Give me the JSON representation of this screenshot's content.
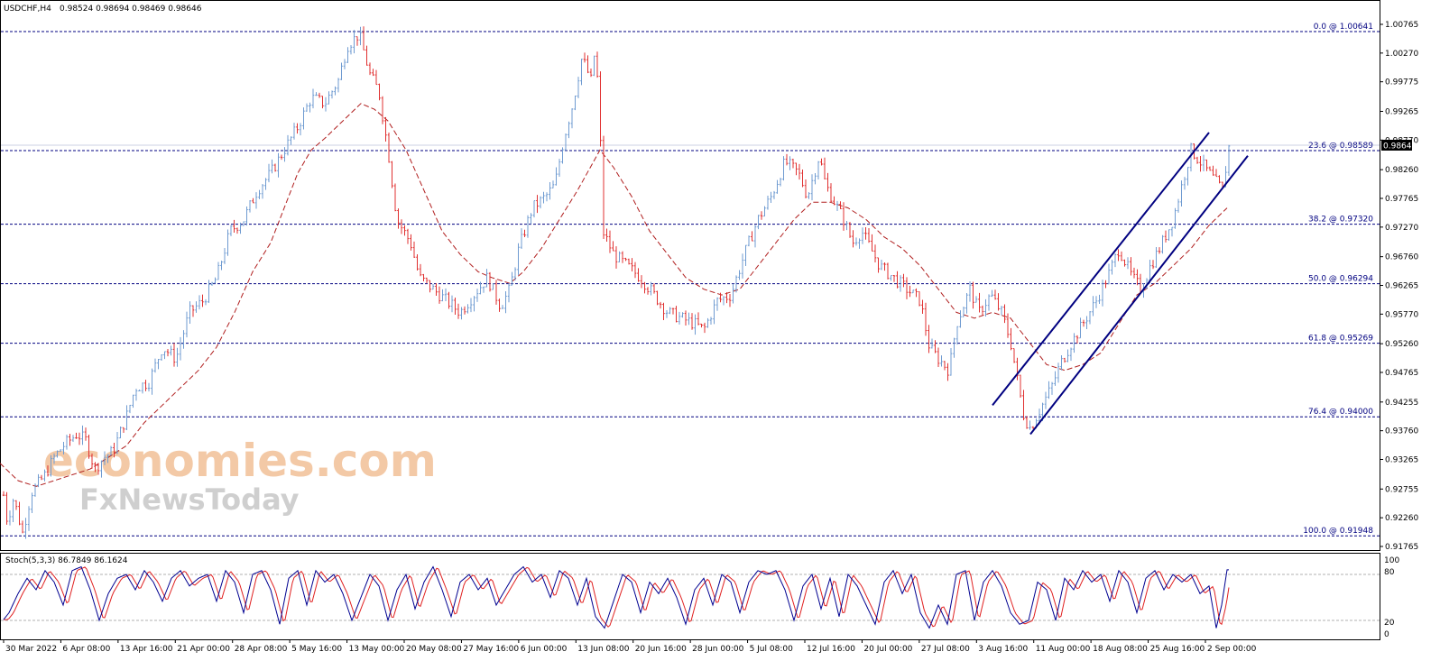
{
  "header": {
    "symbol": "USDCHF,H4",
    "ohlc": "0.98524 0.98694 0.98469 0.98646"
  },
  "watermark": {
    "line1": "economies.com",
    "line2": "FxNewsToday"
  },
  "stoch_panel": {
    "label": "Stoch(5,3,3) 86.7849 86.1624",
    "levels": [
      "100",
      "80",
      "20",
      "0"
    ]
  },
  "current_price": "0.98646",
  "colors": {
    "bull": "#6f9bd1",
    "bear": "#e03030",
    "ma": "#b01e1e",
    "fib": "#000080",
    "channel": "#000080",
    "stoch_main": "#000090",
    "stoch_signal": "#e02020",
    "price_tag": "#000000"
  },
  "chart_data": {
    "type": "candlestick",
    "title": "",
    "y_ticks": [
      "1.00765",
      "1.00270",
      "0.99775",
      "0.99265",
      "0.98770",
      "0.98260",
      "0.97765",
      "0.97270",
      "0.96760",
      "0.96265",
      "0.95770",
      "0.95260",
      "0.94765",
      "0.94255",
      "0.93760",
      "0.93265",
      "0.92755",
      "0.92260",
      "0.91765"
    ],
    "ylim": [
      0.9152,
      1.0087
    ],
    "x_ticks": [
      "30 Mar 2022",
      "6 Apr 08:00",
      "13 Apr 16:00",
      "21 Apr 00:00",
      "28 Apr 08:00",
      "5 May 16:00",
      "13 May 00:00",
      "20 May 08:00",
      "27 May 16:00",
      "6 Jun 00:00",
      "13 Jun 08:00",
      "20 Jun 16:00",
      "28 Jun 00:00",
      "5 Jul 08:00",
      "12 Jul 16:00",
      "20 Jul 00:00",
      "27 Jul 08:00",
      "3 Aug 16:00",
      "11 Aug 00:00",
      "18 Aug 08:00",
      "25 Aug 16:00",
      "2 Sep 00:00"
    ],
    "fib_levels": [
      {
        "label": "0.0 @ 1.00641",
        "price": 1.00641
      },
      {
        "label": "23.6 @ 0.98589",
        "price": 0.98589
      },
      {
        "label": "38.2 @ 0.97320",
        "price": 0.9732
      },
      {
        "label": "50.0 @ 0.96294",
        "price": 0.96294
      },
      {
        "label": "61.8 @ 0.95269",
        "price": 0.95269
      },
      {
        "label": "76.4 @ 0.94000",
        "price": 0.94
      },
      {
        "label": "100.0 @ 0.91948",
        "price": 0.91948
      }
    ],
    "price_path": [
      [
        0,
        0.931
      ],
      [
        8,
        0.922
      ],
      [
        15,
        0.926
      ],
      [
        25,
        0.92
      ],
      [
        35,
        0.927
      ],
      [
        50,
        0.93
      ],
      [
        60,
        0.933
      ],
      [
        70,
        0.935
      ],
      [
        85,
        0.937
      ],
      [
        95,
        0.936
      ],
      [
        105,
        0.931
      ],
      [
        115,
        0.933
      ],
      [
        125,
        0.934
      ],
      [
        140,
        0.94
      ],
      [
        150,
        0.945
      ],
      [
        165,
        0.946
      ],
      [
        180,
        0.952
      ],
      [
        195,
        0.95
      ],
      [
        210,
        0.958
      ],
      [
        225,
        0.96
      ],
      [
        240,
        0.964
      ],
      [
        255,
        0.972
      ],
      [
        270,
        0.974
      ],
      [
        285,
        0.979
      ],
      [
        300,
        0.982
      ],
      [
        315,
        0.986
      ],
      [
        330,
        0.99
      ],
      [
        345,
        0.995
      ],
      [
        360,
        0.994
      ],
      [
        375,
        0.998
      ],
      [
        385,
        1.004
      ],
      [
        398,
        1.006
      ],
      [
        410,
        0.999
      ],
      [
        420,
        0.996
      ],
      [
        430,
        0.986
      ],
      [
        440,
        0.974
      ],
      [
        455,
        0.97
      ],
      [
        465,
        0.964
      ],
      [
        480,
        0.962
      ],
      [
        495,
        0.96
      ],
      [
        510,
        0.958
      ],
      [
        525,
        0.961
      ],
      [
        540,
        0.964
      ],
      [
        555,
        0.959
      ],
      [
        565,
        0.962
      ],
      [
        575,
        0.969
      ],
      [
        590,
        0.976
      ],
      [
        605,
        0.978
      ],
      [
        615,
        0.98
      ],
      [
        625,
        0.988
      ],
      [
        635,
        0.994
      ],
      [
        645,
        1.002
      ],
      [
        655,
        0.998
      ],
      [
        660,
        1.004
      ],
      [
        665,
        0.99
      ],
      [
        668,
        0.972
      ],
      [
        680,
        0.968
      ],
      [
        695,
        0.966
      ],
      [
        710,
        0.964
      ],
      [
        725,
        0.961
      ],
      [
        740,
        0.958
      ],
      [
        755,
        0.957
      ],
      [
        770,
        0.956
      ],
      [
        780,
        0.955
      ],
      [
        795,
        0.96
      ],
      [
        810,
        0.961
      ],
      [
        825,
        0.968
      ],
      [
        840,
        0.974
      ],
      [
        855,
        0.978
      ],
      [
        870,
        0.984
      ],
      [
        885,
        0.982
      ],
      [
        895,
        0.978
      ],
      [
        908,
        0.985
      ],
      [
        915,
        0.98
      ],
      [
        925,
        0.977
      ],
      [
        935,
        0.974
      ],
      [
        945,
        0.97
      ],
      [
        955,
        0.972
      ],
      [
        965,
        0.969
      ],
      [
        975,
        0.966
      ],
      [
        990,
        0.964
      ],
      [
        1005,
        0.962
      ],
      [
        1020,
        0.96
      ],
      [
        1030,
        0.952
      ],
      [
        1040,
        0.95
      ],
      [
        1052,
        0.948
      ],
      [
        1060,
        0.956
      ],
      [
        1075,
        0.962
      ],
      [
        1085,
        0.958
      ],
      [
        1098,
        0.961
      ],
      [
        1110,
        0.958
      ],
      [
        1120,
        0.953
      ],
      [
        1128,
        0.946
      ],
      [
        1135,
        0.94
      ],
      [
        1142,
        0.938
      ],
      [
        1155,
        0.942
      ],
      [
        1165,
        0.945
      ],
      [
        1175,
        0.949
      ],
      [
        1185,
        0.952
      ],
      [
        1200,
        0.956
      ],
      [
        1215,
        0.96
      ],
      [
        1230,
        0.965
      ],
      [
        1240,
        0.969
      ],
      [
        1255,
        0.964
      ],
      [
        1265,
        0.962
      ],
      [
        1275,
        0.966
      ],
      [
        1285,
        0.969
      ],
      [
        1300,
        0.974
      ],
      [
        1310,
        0.98
      ],
      [
        1320,
        0.986
      ],
      [
        1330,
        0.984
      ],
      [
        1345,
        0.981
      ],
      [
        1355,
        0.979
      ],
      [
        1362,
        0.9865
      ]
    ],
    "ma_path": [
      [
        0,
        0.932
      ],
      [
        20,
        0.929
      ],
      [
        40,
        0.928
      ],
      [
        60,
        0.929
      ],
      [
        80,
        0.93
      ],
      [
        100,
        0.931
      ],
      [
        120,
        0.933
      ],
      [
        140,
        0.935
      ],
      [
        160,
        0.939
      ],
      [
        180,
        0.942
      ],
      [
        200,
        0.945
      ],
      [
        220,
        0.948
      ],
      [
        240,
        0.952
      ],
      [
        260,
        0.958
      ],
      [
        280,
        0.965
      ],
      [
        300,
        0.97
      ],
      [
        315,
        0.976
      ],
      [
        330,
        0.982
      ],
      [
        345,
        0.986
      ],
      [
        360,
        0.988
      ],
      [
        380,
        0.991
      ],
      [
        400,
        0.994
      ],
      [
        415,
        0.993
      ],
      [
        430,
        0.991
      ],
      [
        450,
        0.986
      ],
      [
        470,
        0.979
      ],
      [
        490,
        0.972
      ],
      [
        510,
        0.968
      ],
      [
        530,
        0.965
      ],
      [
        545,
        0.964
      ],
      [
        565,
        0.963
      ],
      [
        580,
        0.965
      ],
      [
        600,
        0.969
      ],
      [
        620,
        0.974
      ],
      [
        640,
        0.979
      ],
      [
        665,
        0.986
      ],
      [
        680,
        0.983
      ],
      [
        700,
        0.978
      ],
      [
        720,
        0.972
      ],
      [
        740,
        0.968
      ],
      [
        760,
        0.964
      ],
      [
        780,
        0.962
      ],
      [
        800,
        0.961
      ],
      [
        820,
        0.962
      ],
      [
        840,
        0.966
      ],
      [
        860,
        0.97
      ],
      [
        880,
        0.974
      ],
      [
        900,
        0.977
      ],
      [
        920,
        0.977
      ],
      [
        940,
        0.976
      ],
      [
        960,
        0.974
      ],
      [
        980,
        0.971
      ],
      [
        1000,
        0.969
      ],
      [
        1020,
        0.966
      ],
      [
        1040,
        0.962
      ],
      [
        1060,
        0.958
      ],
      [
        1080,
        0.957
      ],
      [
        1100,
        0.958
      ],
      [
        1120,
        0.957
      ],
      [
        1140,
        0.953
      ],
      [
        1160,
        0.949
      ],
      [
        1180,
        0.948
      ],
      [
        1200,
        0.949
      ],
      [
        1220,
        0.951
      ],
      [
        1240,
        0.956
      ],
      [
        1260,
        0.961
      ],
      [
        1280,
        0.963
      ],
      [
        1300,
        0.966
      ],
      [
        1320,
        0.969
      ],
      [
        1340,
        0.973
      ],
      [
        1360,
        0.976
      ]
    ],
    "channel_lines": [
      {
        "x1": 1100,
        "p1": 0.942,
        "x2": 1340,
        "p2": 0.989
      },
      {
        "x1": 1142,
        "p1": 0.937,
        "x2": 1383,
        "p2": 0.985
      }
    ],
    "stoch_path": [
      [
        0,
        15
      ],
      [
        10,
        30
      ],
      [
        20,
        55
      ],
      [
        30,
        75
      ],
      [
        40,
        60
      ],
      [
        50,
        85
      ],
      [
        60,
        70
      ],
      [
        70,
        40
      ],
      [
        80,
        85
      ],
      [
        90,
        90
      ],
      [
        100,
        60
      ],
      [
        110,
        20
      ],
      [
        120,
        55
      ],
      [
        130,
        75
      ],
      [
        140,
        80
      ],
      [
        150,
        60
      ],
      [
        160,
        85
      ],
      [
        170,
        70
      ],
      [
        180,
        45
      ],
      [
        190,
        75
      ],
      [
        200,
        85
      ],
      [
        210,
        65
      ],
      [
        220,
        75
      ],
      [
        230,
        80
      ],
      [
        240,
        45
      ],
      [
        250,
        85
      ],
      [
        260,
        70
      ],
      [
        270,
        30
      ],
      [
        280,
        80
      ],
      [
        290,
        85
      ],
      [
        300,
        60
      ],
      [
        310,
        15
      ],
      [
        320,
        75
      ],
      [
        330,
        85
      ],
      [
        340,
        40
      ],
      [
        350,
        85
      ],
      [
        360,
        70
      ],
      [
        370,
        80
      ],
      [
        380,
        55
      ],
      [
        390,
        20
      ],
      [
        400,
        50
      ],
      [
        410,
        80
      ],
      [
        420,
        65
      ],
      [
        430,
        20
      ],
      [
        440,
        60
      ],
      [
        450,
        80
      ],
      [
        460,
        35
      ],
      [
        470,
        70
      ],
      [
        480,
        90
      ],
      [
        490,
        60
      ],
      [
        500,
        25
      ],
      [
        510,
        70
      ],
      [
        520,
        80
      ],
      [
        530,
        60
      ],
      [
        540,
        75
      ],
      [
        550,
        40
      ],
      [
        560,
        60
      ],
      [
        570,
        80
      ],
      [
        580,
        90
      ],
      [
        590,
        70
      ],
      [
        600,
        80
      ],
      [
        610,
        50
      ],
      [
        620,
        85
      ],
      [
        630,
        75
      ],
      [
        640,
        40
      ],
      [
        650,
        75
      ],
      [
        660,
        25
      ],
      [
        670,
        10
      ],
      [
        680,
        45
      ],
      [
        690,
        80
      ],
      [
        700,
        70
      ],
      [
        710,
        30
      ],
      [
        720,
        70
      ],
      [
        730,
        55
      ],
      [
        740,
        75
      ],
      [
        750,
        50
      ],
      [
        760,
        15
      ],
      [
        770,
        60
      ],
      [
        780,
        75
      ],
      [
        790,
        40
      ],
      [
        800,
        80
      ],
      [
        810,
        70
      ],
      [
        820,
        30
      ],
      [
        830,
        70
      ],
      [
        840,
        85
      ],
      [
        850,
        80
      ],
      [
        860,
        85
      ],
      [
        870,
        60
      ],
      [
        880,
        20
      ],
      [
        890,
        65
      ],
      [
        900,
        80
      ],
      [
        910,
        35
      ],
      [
        920,
        75
      ],
      [
        930,
        25
      ],
      [
        940,
        80
      ],
      [
        950,
        65
      ],
      [
        960,
        40
      ],
      [
        970,
        15
      ],
      [
        980,
        70
      ],
      [
        990,
        85
      ],
      [
        1000,
        55
      ],
      [
        1010,
        80
      ],
      [
        1020,
        30
      ],
      [
        1030,
        10
      ],
      [
        1040,
        40
      ],
      [
        1050,
        15
      ],
      [
        1060,
        80
      ],
      [
        1070,
        85
      ],
      [
        1080,
        20
      ],
      [
        1090,
        70
      ],
      [
        1100,
        85
      ],
      [
        1110,
        65
      ],
      [
        1120,
        30
      ],
      [
        1130,
        15
      ],
      [
        1140,
        20
      ],
      [
        1150,
        70
      ],
      [
        1160,
        60
      ],
      [
        1170,
        20
      ],
      [
        1180,
        75
      ],
      [
        1190,
        60
      ],
      [
        1200,
        85
      ],
      [
        1210,
        70
      ],
      [
        1220,
        80
      ],
      [
        1230,
        45
      ],
      [
        1240,
        85
      ],
      [
        1250,
        70
      ],
      [
        1260,
        30
      ],
      [
        1270,
        75
      ],
      [
        1280,
        85
      ],
      [
        1290,
        60
      ],
      [
        1300,
        80
      ],
      [
        1310,
        70
      ],
      [
        1320,
        80
      ],
      [
        1330,
        55
      ],
      [
        1340,
        65
      ],
      [
        1348,
        10
      ],
      [
        1354,
        40
      ],
      [
        1360,
        86
      ]
    ]
  }
}
